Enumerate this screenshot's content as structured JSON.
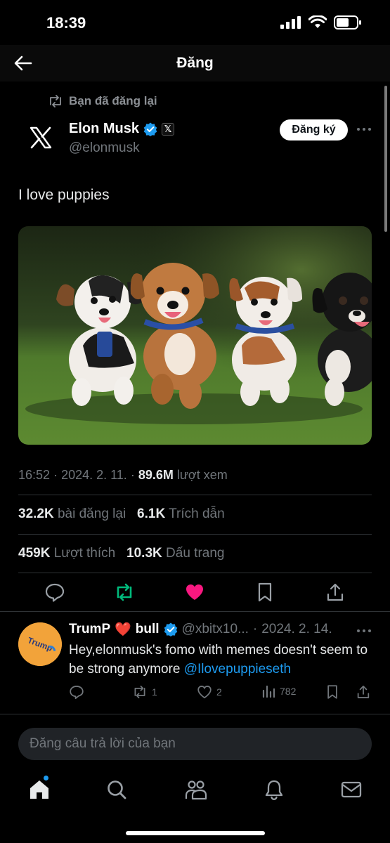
{
  "status_bar": {
    "time": "18:39"
  },
  "header": {
    "title": "Đăng"
  },
  "repost": {
    "label": "Bạn đã đăng lại"
  },
  "author": {
    "name": "Elon Musk",
    "handle": "@elonmusk",
    "x_badge": "𝕏"
  },
  "subscribe": {
    "label": "Đăng ký"
  },
  "post": {
    "text": "I love puppies",
    "time": "16:52",
    "date": "2024. 2. 11.",
    "views": "89.6M",
    "views_label": "lượt xem",
    "reposts": "32.2K",
    "reposts_label": "bài đăng lại",
    "quotes": "6.1K",
    "quotes_label": "Trích dẫn",
    "likes": "459K",
    "likes_label": "Lượt thích",
    "bookmarks": "10.3K",
    "bookmarks_label": "Dấu trang"
  },
  "reply": {
    "name_part1": "TrumP",
    "name_emoji": "❤️",
    "name_part2": "bull",
    "handle": "@xbitx10...",
    "date": "2024. 2. 14.",
    "avatar_text": "Trump",
    "text_main": "Hey,elonmusk's fomo with memes doesn't seem to be strong anymore",
    "mention": "@Ilovepuppieseth",
    "reposts": "1",
    "likes": "2",
    "views": "782"
  },
  "composer": {
    "placeholder": "Đăng câu trả lời của bạn"
  },
  "colors": {
    "accent": "#1d9bf0",
    "like": "#f91880",
    "repost": "#00ba7c",
    "background": "#000000"
  }
}
